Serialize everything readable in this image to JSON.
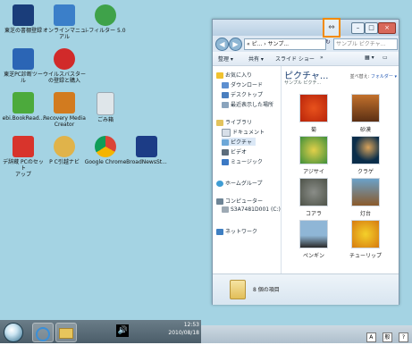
{
  "desktop": {
    "icons": [
      {
        "label": "東芝の書棚登録",
        "color": "#1a3d7a"
      },
      {
        "label": "オンラインマニュ\nアル",
        "color": "#3b7fc9"
      },
      {
        "label": "i-フィルター 5.0",
        "color": "#3fa24a"
      },
      {
        "label": "東芝PC診断ツー\nル",
        "color": "#2b65b5"
      },
      {
        "label": "ウイルスバスター\nの登録と購入",
        "color": "#d12a2a"
      },
      {
        "label": "ebi.BookRead...",
        "color": "#4caa3c"
      },
      {
        "label": "Recovery Media\nCreator",
        "color": "#d27b1f"
      },
      {
        "label": "ごみ箱",
        "color": "#dfe6ea"
      },
      {
        "label": "デ辞蔵 PCのセット\nアップ",
        "color": "#d8342c"
      },
      {
        "label": "P C引越ナビ",
        "color": "#e0b34a"
      },
      {
        "label": "Google Chrome",
        "color": "#3e9a3a"
      },
      {
        "label": "BroadNewsSt...",
        "color": "#1c3c86"
      }
    ],
    "taskbar": {
      "time": "12:53",
      "date": "2010/08/18",
      "volume_symbol": "🔊"
    }
  },
  "explorer": {
    "address_text": "« ピ... › サンプ...",
    "search_placeholder": "サンプル ピクチャ...",
    "highlight_icon_symbol": "⇔",
    "toolbar": {
      "organize": "整理 ▾",
      "share": "共有 ▾",
      "slideshow": "スライド ショー",
      "more": "»"
    },
    "nav": {
      "favorites": "お気に入り",
      "downloads": "ダウンロード",
      "desktop": "デスクトップ",
      "recent": "最近表示した場所",
      "libraries": "ライブラリ",
      "documents": "ドキュメント",
      "pictures": "ピクチャ",
      "videos": "ビデオ",
      "music": "ミュージック",
      "homegroup": "ホームグループ",
      "computer": "コンピューター",
      "drive": "S3A7481D001 (C:)",
      "network": "ネットワーク"
    },
    "library_title": "ピクチャ...",
    "library_subtitle": "サンプル ピクチ...",
    "arrange_label": "並べ替え:",
    "arrange_value": "フォルダー ▾",
    "thumbnails": [
      {
        "caption": "菊",
        "color1": "#e8521c",
        "color2": "#b8240a"
      },
      {
        "caption": "砂漠",
        "color1": "#c2712c",
        "color2": "#5b2f14"
      },
      {
        "caption": "アジサイ",
        "color1": "#3d8f3a",
        "color2": "#e3d04a"
      },
      {
        "caption": "クラゲ",
        "color1": "#0a2d4a",
        "color2": "#d9a35a"
      },
      {
        "caption": "コアラ",
        "color1": "#8a8d88",
        "color2": "#4d5248"
      },
      {
        "caption": "灯台",
        "color1": "#6aa1c9",
        "color2": "#8a5a2c"
      },
      {
        "caption": "ペンギン",
        "color1": "#8fb6d6",
        "color2": "#2a2a2a"
      },
      {
        "caption": "チューリップ",
        "color1": "#f4d02a",
        "color2": "#d67a10"
      }
    ],
    "status_count": "8 個の項目",
    "tray_icons": [
      "A",
      "般",
      "?"
    ]
  }
}
